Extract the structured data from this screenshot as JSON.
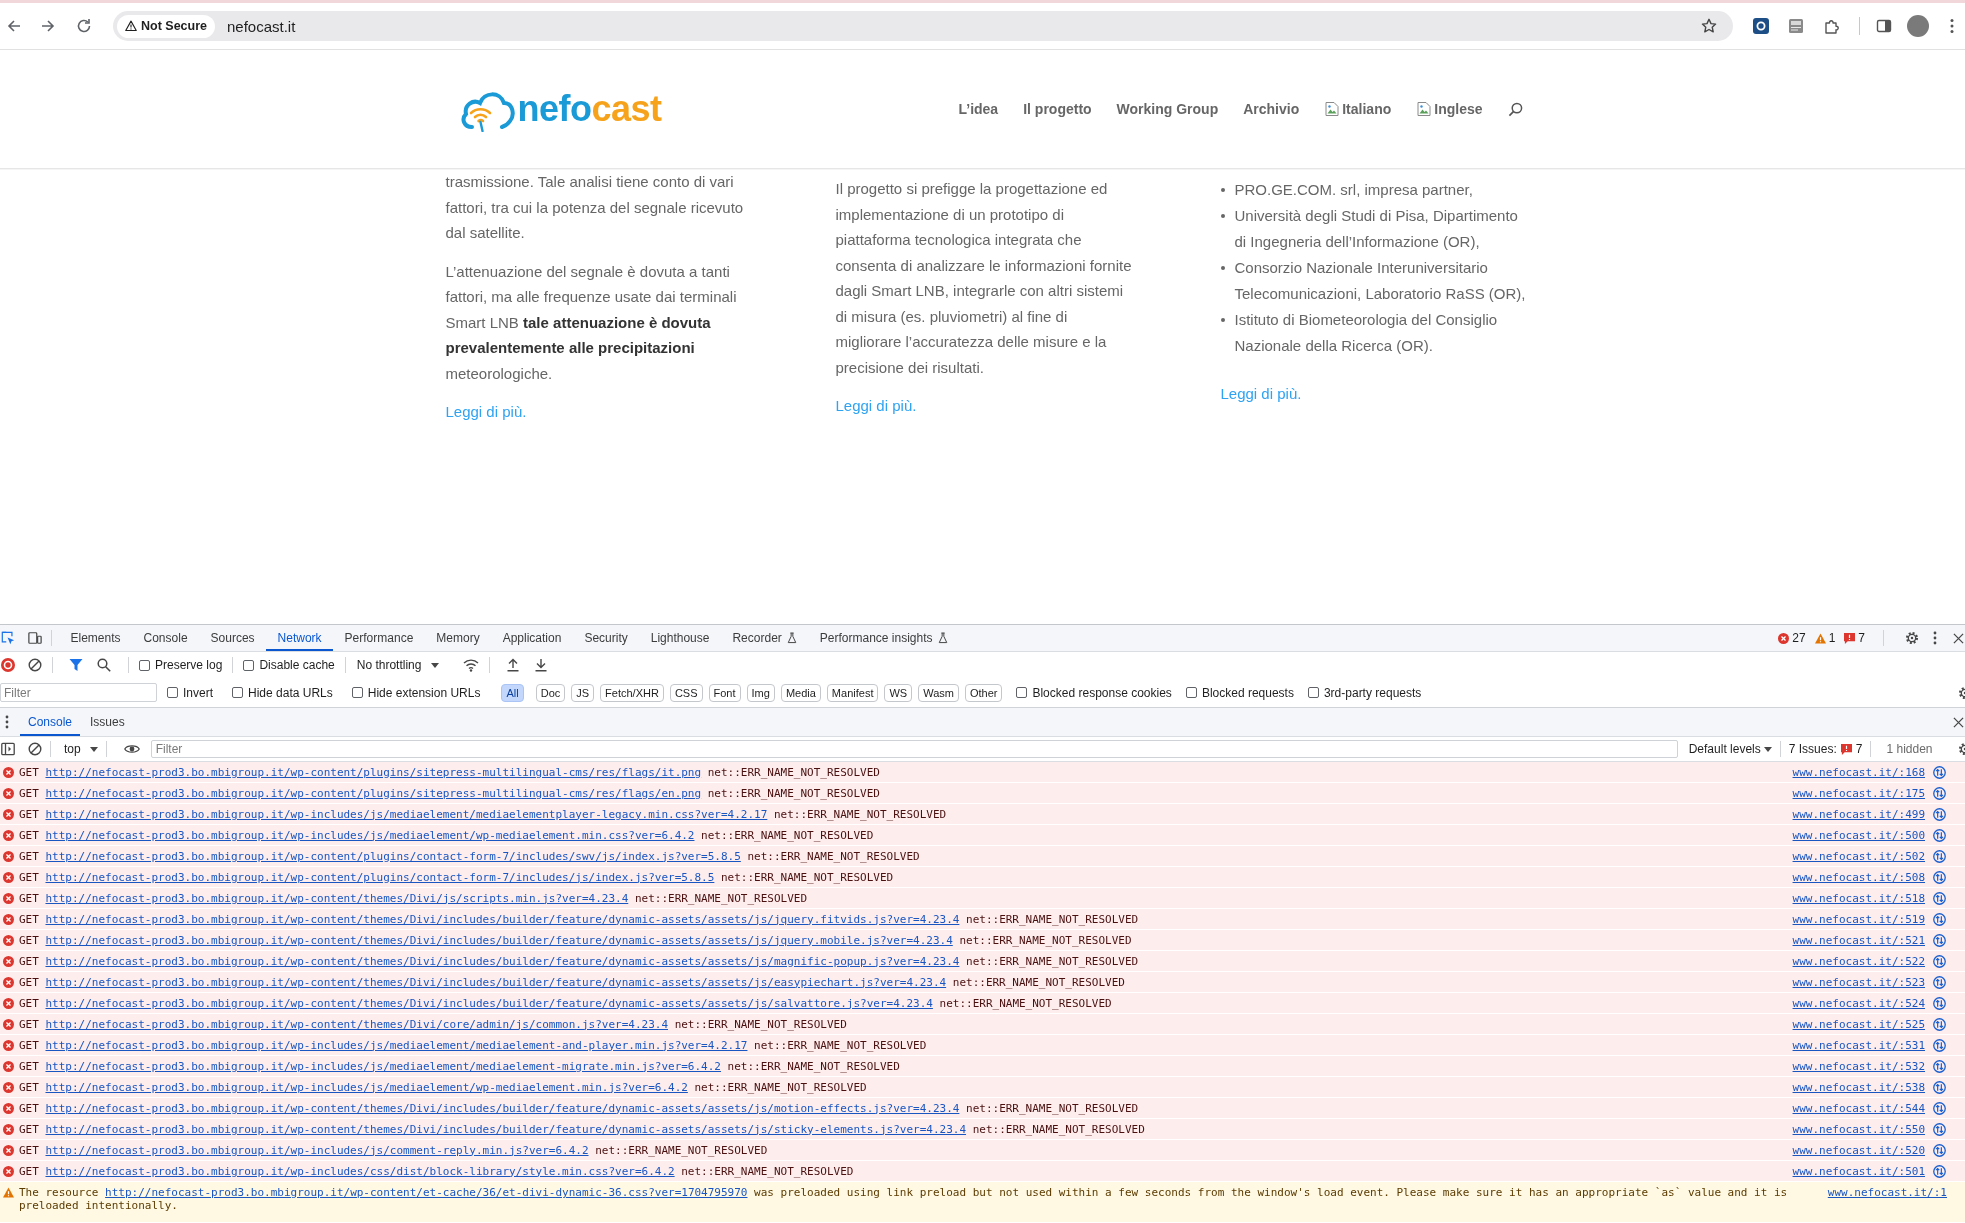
{
  "browser": {
    "security_chip": "Not Secure",
    "url": "nefocast.it"
  },
  "site": {
    "logo": [
      "nefo",
      "cast"
    ],
    "nav": [
      {
        "kind": "link",
        "label": "L’idea"
      },
      {
        "kind": "link",
        "label": "Il progetto"
      },
      {
        "kind": "link",
        "label": "Working Group"
      },
      {
        "kind": "link",
        "label": "Archivio"
      },
      {
        "kind": "image",
        "label": "Italiano"
      },
      {
        "kind": "image",
        "label": "Inglese"
      }
    ],
    "columns": [
      {
        "kind": "paragraphs",
        "paragraphs": [
          "trasmissione. Tale analisi tiene conto di vari fattori, tra cui la potenza del segnale ricevuto dal satellite.",
          "L’attenuazione del segnale è dovuta a tanti fattori, ma alle frequenze usate dai terminali Smart LNB **tale attenuazione è dovuta prevalentemente alle precipitazioni** meteorologiche."
        ],
        "link": "Leggi di più."
      },
      {
        "kind": "paragraphs",
        "paragraphs": [
          "Il progetto si prefigge la progettazione ed implementazione di un prototipo di piattaforma tecnologica integrata che consenta di analizzare le informazioni fornite dagli Smart LNB, integrarle con altri sistemi di misura (es. pluviometri) al fine di migliorare l’accuratezza delle misure e la precisione dei risultati."
        ],
        "link": "Leggi di più."
      },
      {
        "kind": "list",
        "items": [
          "PRO.GE.COM. srl, impresa partner,",
          "Università degli Studi di Pisa, Dipartimento di Ingegneria dell’Informazione (OR),",
          "Consorzio Nazionale Interuniversitario Telecomunicazioni, Laboratorio RaSS (OR),",
          "Istituto di Biometeorologia del Consiglio Nazionale della Ricerca (OR)."
        ],
        "link": "Leggi di più."
      }
    ]
  },
  "devtools": {
    "tabs": [
      {
        "label": "Elements",
        "kind": "plain",
        "selected": false
      },
      {
        "label": "Console",
        "kind": "plain",
        "selected": false
      },
      {
        "label": "Sources",
        "kind": "plain",
        "selected": false
      },
      {
        "label": "Network",
        "kind": "plain",
        "selected": true
      },
      {
        "label": "Performance",
        "kind": "plain",
        "selected": false
      },
      {
        "label": "Memory",
        "kind": "plain",
        "selected": false
      },
      {
        "label": "Application",
        "kind": "plain",
        "selected": false
      },
      {
        "label": "Security",
        "kind": "plain",
        "selected": false
      },
      {
        "label": "Lighthouse",
        "kind": "plain",
        "selected": false
      },
      {
        "label": "Recorder",
        "kind": "experimental",
        "selected": false
      },
      {
        "label": "Performance insights",
        "kind": "experimental",
        "selected": false
      }
    ],
    "counters": [
      {
        "kind": "error",
        "count": "27"
      },
      {
        "kind": "warning",
        "count": "1"
      },
      {
        "kind": "issue",
        "count": "7"
      }
    ],
    "network_toolbar": {
      "checkboxes": [
        {
          "label": "Preserve log",
          "checked": false
        },
        {
          "label": "Disable cache",
          "checked": false
        }
      ],
      "throttling": "No throttling"
    },
    "filter_bar": {
      "placeholder": "Filter",
      "options": [
        {
          "label": "Invert",
          "checked": false
        },
        {
          "label": "Hide data URLs",
          "checked": false
        },
        {
          "label": "Hide extension URLs",
          "checked": false
        }
      ],
      "types": [
        {
          "label": "All",
          "selected": true
        },
        {
          "label": "Doc",
          "selected": false
        },
        {
          "label": "JS",
          "selected": false
        },
        {
          "label": "Fetch/XHR",
          "selected": false
        },
        {
          "label": "CSS",
          "selected": false
        },
        {
          "label": "Font",
          "selected": false
        },
        {
          "label": "Img",
          "selected": false
        },
        {
          "label": "Media",
          "selected": false
        },
        {
          "label": "Manifest",
          "selected": false
        },
        {
          "label": "WS",
          "selected": false
        },
        {
          "label": "Wasm",
          "selected": false
        },
        {
          "label": "Other",
          "selected": false
        }
      ],
      "more_options": [
        {
          "label": "Blocked response cookies",
          "checked": false
        },
        {
          "label": "Blocked requests",
          "checked": false
        },
        {
          "label": "3rd-party requests",
          "checked": false
        }
      ]
    },
    "drawer": {
      "tabs": [
        {
          "label": "Console",
          "selected": true
        },
        {
          "label": "Issues",
          "selected": false
        }
      ]
    },
    "console": {
      "context": "top",
      "placeholder": "Filter",
      "levels": "Default levels",
      "issues_label": "7 Issues:",
      "issues_count": "7",
      "hidden": "1 hidden",
      "messages": [
        {
          "kind": "error",
          "method": "GET",
          "url": "http://nefocast-prod3.bo.mbigroup.it/wp-content/plugins/sitepress-multilingual-cms/res/flags/it.png",
          "message": "net::ERR_NAME_NOT_RESOLVED",
          "source": "www.nefocast.it/:168"
        },
        {
          "kind": "error",
          "method": "GET",
          "url": "http://nefocast-prod3.bo.mbigroup.it/wp-content/plugins/sitepress-multilingual-cms/res/flags/en.png",
          "message": "net::ERR_NAME_NOT_RESOLVED",
          "source": "www.nefocast.it/:175"
        },
        {
          "kind": "error",
          "method": "GET",
          "url": "http://nefocast-prod3.bo.mbigroup.it/wp-includes/js/mediaelement/mediaelementplayer-legacy.min.css?ver=4.2.17",
          "message": "net::ERR_NAME_NOT_RESOLVED",
          "source": "www.nefocast.it/:499"
        },
        {
          "kind": "error",
          "method": "GET",
          "url": "http://nefocast-prod3.bo.mbigroup.it/wp-includes/js/mediaelement/wp-mediaelement.min.css?ver=6.4.2",
          "message": "net::ERR_NAME_NOT_RESOLVED",
          "source": "www.nefocast.it/:500"
        },
        {
          "kind": "error",
          "method": "GET",
          "url": "http://nefocast-prod3.bo.mbigroup.it/wp-content/plugins/contact-form-7/includes/swv/js/index.js?ver=5.8.5",
          "message": "net::ERR_NAME_NOT_RESOLVED",
          "source": "www.nefocast.it/:502"
        },
        {
          "kind": "error",
          "method": "GET",
          "url": "http://nefocast-prod3.bo.mbigroup.it/wp-content/plugins/contact-form-7/includes/js/index.js?ver=5.8.5",
          "message": "net::ERR_NAME_NOT_RESOLVED",
          "source": "www.nefocast.it/:508"
        },
        {
          "kind": "error",
          "method": "GET",
          "url": "http://nefocast-prod3.bo.mbigroup.it/wp-content/themes/Divi/js/scripts.min.js?ver=4.23.4",
          "message": "net::ERR_NAME_NOT_RESOLVED",
          "source": "www.nefocast.it/:518"
        },
        {
          "kind": "error",
          "method": "GET",
          "url": "http://nefocast-prod3.bo.mbigroup.it/wp-content/themes/Divi/includes/builder/feature/dynamic-assets/assets/js/jquery.fitvids.js?ver=4.23.4",
          "message": "net::ERR_NAME_NOT_RESOLVED",
          "source": "www.nefocast.it/:519"
        },
        {
          "kind": "error",
          "method": "GET",
          "url": "http://nefocast-prod3.bo.mbigroup.it/wp-content/themes/Divi/includes/builder/feature/dynamic-assets/assets/js/jquery.mobile.js?ver=4.23.4",
          "message": "net::ERR_NAME_NOT_RESOLVED",
          "source": "www.nefocast.it/:521"
        },
        {
          "kind": "error",
          "method": "GET",
          "url": "http://nefocast-prod3.bo.mbigroup.it/wp-content/themes/Divi/includes/builder/feature/dynamic-assets/assets/js/magnific-popup.js?ver=4.23.4",
          "message": "net::ERR_NAME_NOT_RESOLVED",
          "source": "www.nefocast.it/:522"
        },
        {
          "kind": "error",
          "method": "GET",
          "url": "http://nefocast-prod3.bo.mbigroup.it/wp-content/themes/Divi/includes/builder/feature/dynamic-assets/assets/js/easypiechart.js?ver=4.23.4",
          "message": "net::ERR_NAME_NOT_RESOLVED",
          "source": "www.nefocast.it/:523"
        },
        {
          "kind": "error",
          "method": "GET",
          "url": "http://nefocast-prod3.bo.mbigroup.it/wp-content/themes/Divi/includes/builder/feature/dynamic-assets/assets/js/salvattore.js?ver=4.23.4",
          "message": "net::ERR_NAME_NOT_RESOLVED",
          "source": "www.nefocast.it/:524"
        },
        {
          "kind": "error",
          "method": "GET",
          "url": "http://nefocast-prod3.bo.mbigroup.it/wp-content/themes/Divi/core/admin/js/common.js?ver=4.23.4",
          "message": "net::ERR_NAME_NOT_RESOLVED",
          "source": "www.nefocast.it/:525"
        },
        {
          "kind": "error",
          "method": "GET",
          "url": "http://nefocast-prod3.bo.mbigroup.it/wp-includes/js/mediaelement/mediaelement-and-player.min.js?ver=4.2.17",
          "message": "net::ERR_NAME_NOT_RESOLVED",
          "source": "www.nefocast.it/:531"
        },
        {
          "kind": "error",
          "method": "GET",
          "url": "http://nefocast-prod3.bo.mbigroup.it/wp-includes/js/mediaelement/mediaelement-migrate.min.js?ver=6.4.2",
          "message": "net::ERR_NAME_NOT_RESOLVED",
          "source": "www.nefocast.it/:532"
        },
        {
          "kind": "error",
          "method": "GET",
          "url": "http://nefocast-prod3.bo.mbigroup.it/wp-includes/js/mediaelement/wp-mediaelement.min.js?ver=6.4.2",
          "message": "net::ERR_NAME_NOT_RESOLVED",
          "source": "www.nefocast.it/:538"
        },
        {
          "kind": "error",
          "method": "GET",
          "url": "http://nefocast-prod3.bo.mbigroup.it/wp-content/themes/Divi/includes/builder/feature/dynamic-assets/assets/js/motion-effects.js?ver=4.23.4",
          "message": "net::ERR_NAME_NOT_RESOLVED",
          "source": "www.nefocast.it/:544"
        },
        {
          "kind": "error",
          "method": "GET",
          "url": "http://nefocast-prod3.bo.mbigroup.it/wp-content/themes/Divi/includes/builder/feature/dynamic-assets/assets/js/sticky-elements.js?ver=4.23.4",
          "message": "net::ERR_NAME_NOT_RESOLVED",
          "source": "www.nefocast.it/:550"
        },
        {
          "kind": "error",
          "method": "GET",
          "url": "http://nefocast-prod3.bo.mbigroup.it/wp-includes/js/comment-reply.min.js?ver=6.4.2",
          "message": "net::ERR_NAME_NOT_RESOLVED",
          "source": "www.nefocast.it/:520"
        },
        {
          "kind": "error",
          "method": "GET",
          "url": "http://nefocast-prod3.bo.mbigroup.it/wp-includes/css/dist/block-library/style.min.css?ver=6.4.2",
          "message": "net::ERR_NAME_NOT_RESOLVED",
          "source": "www.nefocast.it/:501"
        },
        {
          "kind": "warning",
          "before": "The resource",
          "url": "http://nefocast-prod3.bo.mbigroup.it/wp-content/et-cache/36/et-divi-dynamic-36.css?ver=1704795970",
          "after": "was preloaded using link preload but not used within a few seconds from the window's load event. Please make sure it has an appropriate `as` value and it is preloaded intentionally.",
          "source": "www.nefocast.it/:1"
        }
      ]
    }
  }
}
